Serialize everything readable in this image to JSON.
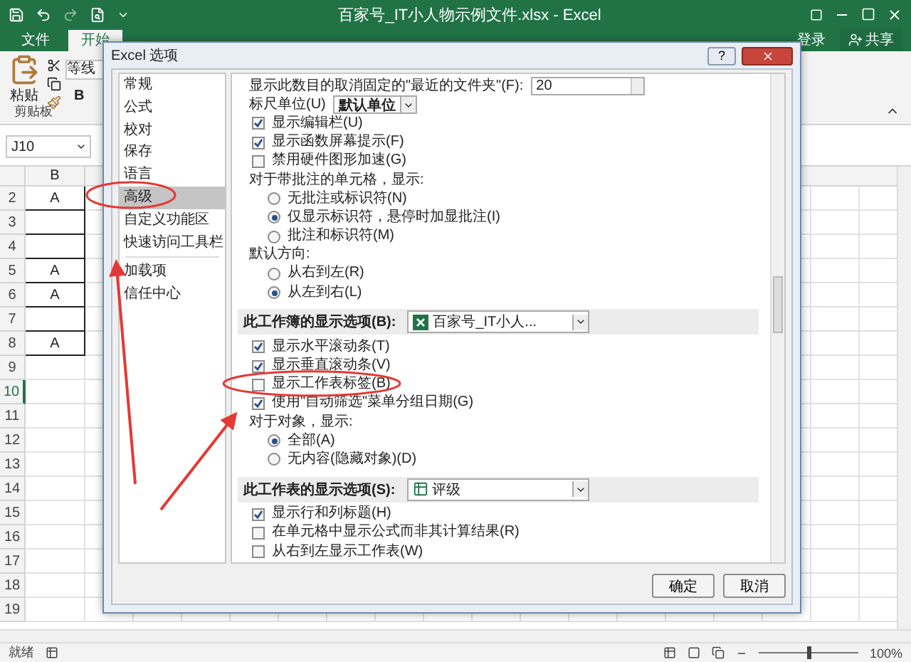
{
  "window": {
    "title": "百家号_IT小人物示例文件.xlsx - Excel"
  },
  "ribbon_tabs": [
    {
      "label": "文件",
      "selected": false
    },
    {
      "label": "开始",
      "selected": true
    }
  ],
  "account": {
    "login": "登录",
    "share": "共享"
  },
  "ribbon": {
    "paste": "粘贴",
    "font": "等线",
    "bold": "B",
    "group": "剪贴板"
  },
  "name_box": "J10",
  "sheet": {
    "column": "B",
    "rows": [
      {
        "number": "2",
        "value": "A",
        "selected": false
      },
      {
        "number": "3",
        "selected": false
      },
      {
        "number": "4",
        "selected": false
      },
      {
        "number": "5",
        "value": "A",
        "selected": false
      },
      {
        "number": "6",
        "value": "A",
        "selected": false
      },
      {
        "number": "7",
        "selected": false
      },
      {
        "number": "8",
        "value": "A",
        "selected": false
      },
      {
        "number": "9",
        "selected": false
      },
      {
        "number": "10",
        "selected": true
      },
      {
        "number": "11",
        "selected": false
      },
      {
        "number": "12",
        "selected": false
      },
      {
        "number": "13",
        "selected": false
      },
      {
        "number": "14",
        "selected": false
      },
      {
        "number": "15",
        "selected": false
      },
      {
        "number": "16",
        "selected": false
      },
      {
        "number": "17",
        "selected": false
      },
      {
        "number": "18",
        "selected": false
      },
      {
        "number": "19",
        "selected": false
      }
    ]
  },
  "status_bar": {
    "ready": "就绪",
    "zoom": "100%",
    "level": 0.5
  },
  "dialog": {
    "title": "Excel 选项",
    "help": "?",
    "nav": [
      {
        "label": "常规",
        "selected": false
      },
      {
        "label": "公式",
        "selected": false
      },
      {
        "label": "校对",
        "selected": false
      },
      {
        "label": "保存",
        "selected": false
      },
      {
        "label": "语言",
        "selected": false
      },
      {
        "label": "高级",
        "selected": true
      },
      {
        "label": "自定义功能区",
        "selected": false
      },
      {
        "label": "快速访问工具栏",
        "selected": false
      },
      {
        "label": "加载项",
        "selected": false
      },
      {
        "label": "信任中心",
        "selected": false
      }
    ],
    "options": [
      {
        "kind": "spin",
        "label": "显示此数目的取消固定的\"最近的文件夹\"(F):",
        "value": "20"
      },
      {
        "kind": "select",
        "label": "标尺单位(U)",
        "value": "默认单位"
      },
      {
        "kind": "check",
        "label": "显示编辑栏(U)",
        "checked": true
      },
      {
        "kind": "check",
        "label": "显示函数屏幕提示(F)",
        "checked": true
      },
      {
        "kind": "check",
        "label": "禁用硬件图形加速(G)",
        "checked": false
      },
      {
        "kind": "label",
        "label": "对于带批注的单元格，显示:"
      },
      {
        "kind": "radio",
        "label": "无批注或标识符(N)",
        "selected": false
      },
      {
        "kind": "radio",
        "label": "仅显示标识符，悬停时加显批注(I)",
        "selected": true
      },
      {
        "kind": "radio",
        "label": "批注和标识符(M)",
        "selected": false
      },
      {
        "kind": "label",
        "label": "默认方向:"
      },
      {
        "kind": "radio",
        "label": "从右到左(R)",
        "selected": false
      },
      {
        "kind": "radio",
        "label": "从左到右(L)",
        "selected": true
      },
      {
        "kind": "workbook",
        "label": "此工作簿的显示选项(B):",
        "value": "百家号_IT小人..."
      },
      {
        "kind": "check",
        "label": "显示水平滚动条(T)",
        "checked": true
      },
      {
        "kind": "check",
        "label": "显示垂直滚动条(V)",
        "checked": true
      },
      {
        "kind": "check",
        "label": "显示工作表标签(B)",
        "checked": false
      },
      {
        "kind": "check",
        "label": "使用\"自动筛选\"菜单分组日期(G)",
        "checked": true
      },
      {
        "kind": "label",
        "label": "对于对象，显示:"
      },
      {
        "kind": "radio",
        "label": "全部(A)",
        "selected": true
      },
      {
        "kind": "radio",
        "label": "无内容(隐藏对象)(D)",
        "selected": false
      },
      {
        "kind": "worksheet",
        "label": "此工作表的显示选项(S):",
        "value": "评级"
      },
      {
        "kind": "check",
        "label": "显示行和列标题(H)",
        "checked": true
      },
      {
        "kind": "check",
        "label": "在单元格中显示公式而非其计算结果(R)",
        "checked": false
      },
      {
        "kind": "check",
        "label": "从右到左显示工作表(W)",
        "checked": false
      }
    ],
    "buttons": [
      {
        "label": "确定"
      },
      {
        "label": "取消"
      }
    ]
  }
}
